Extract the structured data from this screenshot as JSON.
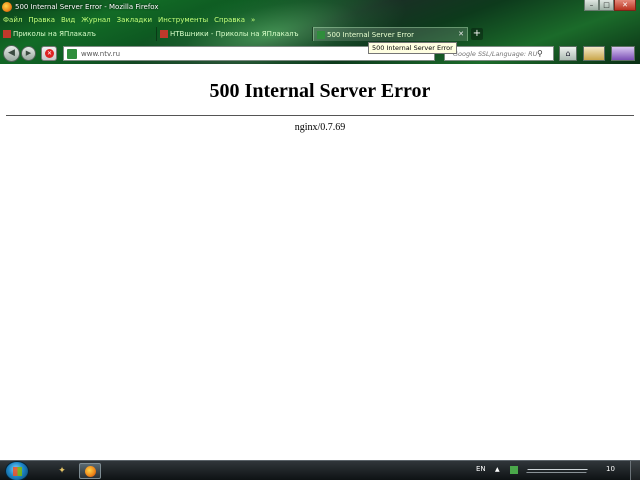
{
  "window": {
    "title": "500 Internal Server Error - Mozilla Firefox",
    "minimize_glyph": "–",
    "maximize_glyph": "□",
    "close_glyph": "✕"
  },
  "menu": {
    "items": [
      "Файл",
      "Правка",
      "Вид",
      "Журнал",
      "Закладки",
      "Инструменты",
      "Справка"
    ],
    "more": "»"
  },
  "tabs": [
    {
      "label": "Приколы на ЯПлакалъ",
      "active": false
    },
    {
      "label": "НТВшники - Приколы на ЯПлакалъ",
      "active": false
    },
    {
      "label": "500 Internal Server Error",
      "active": true
    }
  ],
  "tab_close_glyph": "✕",
  "new_tab_glyph": "+",
  "tooltip": "500 Internal Server Error",
  "navbar": {
    "back_glyph": "◀",
    "forward_glyph": "▶",
    "url": "www.ntv.ru",
    "search_placeholder": "Google SSL/Language: RU",
    "search_glyph": "⚲",
    "home_glyph": "⌂"
  },
  "page": {
    "heading": "500 Internal Server Error",
    "server": "nginx/0.7.69"
  },
  "taskbar": {
    "language": "EN",
    "tray_arrow": "▲",
    "clock": "10"
  },
  "colors": {
    "menu_text": "#c4ff7a",
    "chrome_green": "#126b26"
  }
}
